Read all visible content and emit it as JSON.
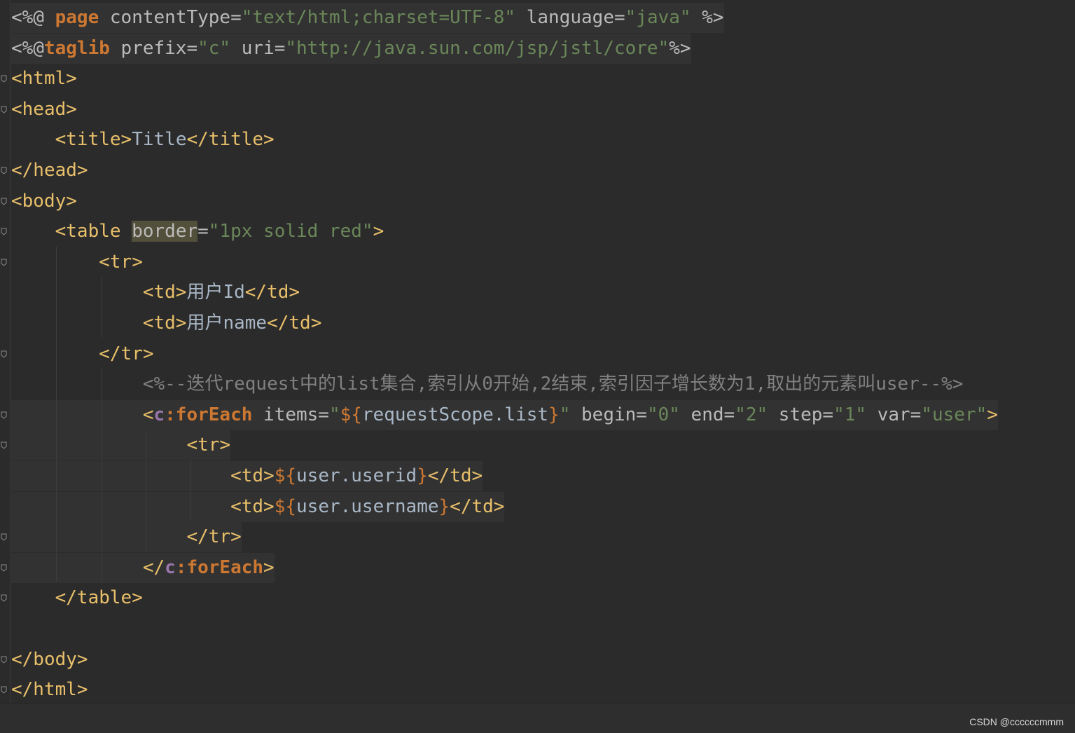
{
  "editor": {
    "lines": [
      {
        "segs": [
          {
            "c": "a",
            "t": "<%@ "
          },
          {
            "c": "k",
            "t": "page"
          },
          {
            "c": "a",
            "t": " contentType="
          },
          {
            "c": "s",
            "t": "\"text/html;charset=UTF-8\""
          },
          {
            "c": "a",
            "t": " language="
          },
          {
            "c": "s",
            "t": "\"java\""
          },
          {
            "c": "a",
            "t": " %>"
          }
        ]
      },
      {
        "segs": [
          {
            "c": "a",
            "t": "<%@"
          },
          {
            "c": "k",
            "t": "taglib"
          },
          {
            "c": "a",
            "t": " prefix="
          },
          {
            "c": "s",
            "t": "\"c\""
          },
          {
            "c": "a",
            "t": " uri="
          },
          {
            "c": "s",
            "t": "\"http://java.sun.com/jsp/jstl/core\""
          },
          {
            "c": "a",
            "t": "%>"
          }
        ]
      },
      {
        "segs": [
          {
            "c": "t",
            "t": "<html>"
          }
        ]
      },
      {
        "segs": [
          {
            "c": "t",
            "t": "<head>"
          }
        ]
      },
      {
        "segs": [
          {
            "c": "ident",
            "t": "    "
          },
          {
            "c": "t",
            "t": "<title>"
          },
          {
            "c": "ident",
            "t": "Title"
          },
          {
            "c": "t",
            "t": "</title>"
          }
        ]
      },
      {
        "segs": [
          {
            "c": "t",
            "t": "</head>"
          }
        ]
      },
      {
        "segs": [
          {
            "c": "t",
            "t": "<body>"
          }
        ]
      },
      {
        "segs": [
          {
            "c": "ident",
            "t": "    "
          },
          {
            "c": "t",
            "t": "<table "
          },
          {
            "c": "a mark",
            "t": "border"
          },
          {
            "c": "a",
            "t": "="
          },
          {
            "c": "s",
            "t": "\"1px solid red\""
          },
          {
            "c": "t",
            "t": ">"
          }
        ]
      },
      {
        "segs": [
          {
            "c": "ident",
            "t": "        "
          },
          {
            "c": "t",
            "t": "<tr>"
          }
        ]
      },
      {
        "segs": [
          {
            "c": "ident",
            "t": "            "
          },
          {
            "c": "t",
            "t": "<td>"
          },
          {
            "c": "ident",
            "t": "用户Id"
          },
          {
            "c": "t",
            "t": "</td>"
          }
        ]
      },
      {
        "segs": [
          {
            "c": "ident",
            "t": "            "
          },
          {
            "c": "t",
            "t": "<td>"
          },
          {
            "c": "ident",
            "t": "用户name"
          },
          {
            "c": "t",
            "t": "</td>"
          }
        ]
      },
      {
        "segs": [
          {
            "c": "ident",
            "t": "        "
          },
          {
            "c": "t",
            "t": "</tr>"
          }
        ]
      },
      {
        "segs": [
          {
            "c": "ident",
            "t": "            "
          },
          {
            "c": "c",
            "t": "<%--迭代request中的list集合,索引从0开始,2结束,索引因子增长数为1,取出的元素叫user--%>"
          }
        ]
      },
      {
        "segs": [
          {
            "c": "ident",
            "t": "            "
          },
          {
            "c": "t",
            "t": "<"
          },
          {
            "c": "p",
            "t": "c"
          },
          {
            "c": "k",
            "t": ":forEach"
          },
          {
            "c": "a",
            "t": " items="
          },
          {
            "c": "s",
            "t": "\""
          },
          {
            "c": "e",
            "t": "${"
          },
          {
            "c": "ident",
            "t": "requestScope.list"
          },
          {
            "c": "e",
            "t": "}"
          },
          {
            "c": "s",
            "t": "\""
          },
          {
            "c": "a",
            "t": " begin="
          },
          {
            "c": "s",
            "t": "\"0\""
          },
          {
            "c": "a",
            "t": " end="
          },
          {
            "c": "s",
            "t": "\"2\""
          },
          {
            "c": "a",
            "t": " step="
          },
          {
            "c": "s",
            "t": "\"1\""
          },
          {
            "c": "a",
            "t": " var="
          },
          {
            "c": "s",
            "t": "\"user\""
          },
          {
            "c": "t",
            "t": ">"
          }
        ]
      },
      {
        "segs": [
          {
            "c": "ident",
            "t": "                "
          },
          {
            "c": "t",
            "t": "<tr>"
          }
        ]
      },
      {
        "segs": [
          {
            "c": "ident",
            "t": "                    "
          },
          {
            "c": "t",
            "t": "<td>"
          },
          {
            "c": "e",
            "t": "${"
          },
          {
            "c": "ident",
            "t": "user.userid"
          },
          {
            "c": "e",
            "t": "}"
          },
          {
            "c": "t",
            "t": "</td>"
          }
        ]
      },
      {
        "segs": [
          {
            "c": "ident",
            "t": "                    "
          },
          {
            "c": "t",
            "t": "<td>"
          },
          {
            "c": "e",
            "t": "${"
          },
          {
            "c": "ident",
            "t": "user.username"
          },
          {
            "c": "e",
            "t": "}"
          },
          {
            "c": "t",
            "t": "</td>"
          }
        ]
      },
      {
        "segs": [
          {
            "c": "ident",
            "t": "                "
          },
          {
            "c": "t",
            "t": "</tr>"
          }
        ]
      },
      {
        "segs": [
          {
            "c": "ident",
            "t": "            "
          },
          {
            "c": "t",
            "t": "</"
          },
          {
            "c": "p",
            "t": "c"
          },
          {
            "c": "k",
            "t": ":forEach"
          },
          {
            "c": "t",
            "t": ">"
          }
        ]
      },
      {
        "segs": [
          {
            "c": "ident",
            "t": "    "
          },
          {
            "c": "t",
            "t": "</table>"
          }
        ]
      },
      {
        "segs": []
      },
      {
        "segs": [
          {
            "c": "t",
            "t": "</body>"
          }
        ]
      },
      {
        "segs": [
          {
            "c": "t",
            "t": "</html>"
          }
        ]
      }
    ]
  },
  "watermark": "CSDN @ccccccmmm",
  "colors": {
    "background": "#2b2b2b",
    "tag": "#e8bf6a",
    "string": "#6a8759",
    "keyword": "#cc7832",
    "prefix": "#9876aa",
    "comment": "#808080",
    "text": "#a9b7c6"
  }
}
